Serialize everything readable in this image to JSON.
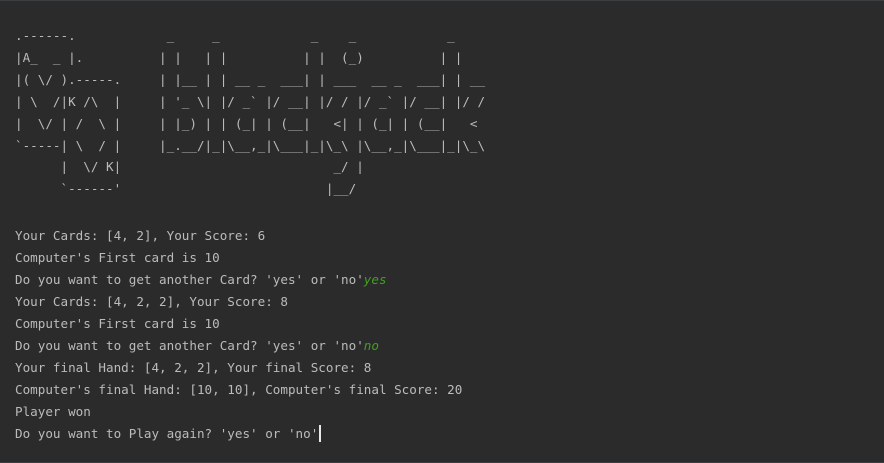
{
  "ascii_art": ".------.            _     _            _    _            _\n|A_  _ |.          | |   | |          | |  (_)          | |\n|( \\/ ).-----.     | |__ | | __ _  ___| | ___  __ _  ___| | __\n| \\  /|K /\\  |     | '_ \\| |/ _` |/ __| |/ / |/ _` |/ __| |/ /\n|  \\/ | /  \\ |     | |_) | | (_| | (__|   <| | (_| | (__|   <\n`-----| \\  / |     |_.__/|_|\\__,_|\\___|_|\\_\\ |\\__,_|\\___|_|\\_\\\n      |  \\/ K|                            _/ |\n      `------'                           |__/",
  "output": [
    {
      "text": "Your Cards: [4, 2], Your Score: 6",
      "input": ""
    },
    {
      "text": "Computer's First card is 10",
      "input": ""
    },
    {
      "text": "Do you want to get another Card? 'yes' or 'no'",
      "input": "yes"
    },
    {
      "text": "Your Cards: [4, 2, 2], Your Score: 8",
      "input": ""
    },
    {
      "text": "Computer's First card is 10",
      "input": ""
    },
    {
      "text": "Do you want to get another Card? 'yes' or 'no'",
      "input": "no"
    },
    {
      "text": "Your final Hand: [4, 2, 2], Your final Score: 8",
      "input": ""
    },
    {
      "text": "Computer's final Hand: [10, 10], Computer's final Score: 20",
      "input": ""
    },
    {
      "text": "Player won",
      "input": ""
    },
    {
      "text": "Do you want to Play again? 'yes' or 'no'",
      "input": ""
    }
  ],
  "colors": {
    "background": "#2b2b2b",
    "text": "#bbbbbb",
    "user_input": "#3f9f22",
    "caret": "#e8e8e8"
  }
}
